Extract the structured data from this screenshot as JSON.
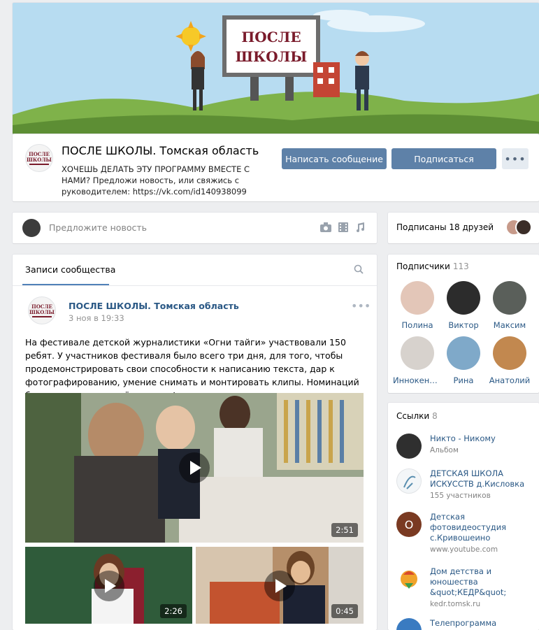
{
  "cover": {
    "sign_line1": "ПОСЛЕ",
    "sign_line2": "ШКОЛЫ"
  },
  "group": {
    "logo_line1": "ПОСЛЕ",
    "logo_line2": "ШКОЛЫ",
    "title": "ПОСЛЕ ШКОЛЫ. Томская область",
    "status": "ХОЧЕШЬ ДЕЛАТЬ ЭТУ ПРОГРАММУ ВМЕСТЕ С НАМИ? Предложи новость, или свяжись с руководителем: https://vk.com/id140938099"
  },
  "actions": {
    "message_label": "Написать сообщение",
    "subscribe_label": "Подписаться",
    "more_label": "•••"
  },
  "suggest": {
    "placeholder": "Предложите новость"
  },
  "wall": {
    "tab_label": "Записи сообщества",
    "post": {
      "author": "ПОСЛЕ ШКОЛЫ. Томская область",
      "date": "3 ноя в 19:33",
      "text": "На фестивале детской журналистики «Огни тайги» участвовали 150 ребят. У участников фестиваля было всего три дня, для того, чтобы продемонстрировать свои способности к написанию текста, дар к фотографированию, умение снимать и монтировать клипы. Номинаций было много, вот призёры видео!",
      "videos": [
        {
          "duration": "2:51"
        },
        {
          "duration": "2:26"
        },
        {
          "duration": "0:45"
        }
      ]
    }
  },
  "friends": {
    "label": "Подписаны 18 друзей"
  },
  "subscribers": {
    "title": "Подписчики",
    "count": "113",
    "people": [
      {
        "name": "Полина"
      },
      {
        "name": "Виктор"
      },
      {
        "name": "Максим"
      },
      {
        "name": "Иннокенти..."
      },
      {
        "name": "Рина"
      },
      {
        "name": "Анатолий"
      }
    ]
  },
  "links": {
    "title": "Ссылки",
    "count": "8",
    "items": [
      {
        "title": "Никто - Никому",
        "subtitle": "Альбом"
      },
      {
        "title": "ДЕТСКАЯ ШКОЛА ИСКУССТВ д.Кисловка",
        "subtitle": "155 участников"
      },
      {
        "title": "Детская фотовидеостудия с.Кривошеино",
        "subtitle": "www.youtube.com",
        "icon_letter": "О"
      },
      {
        "title": "Дом детства и юношества &quot;КЕДР&quot;",
        "subtitle": "kedr.tomsk.ru"
      },
      {
        "title": "Телепрограмма",
        "subtitle": ""
      }
    ]
  },
  "colors": {
    "accent": "#5e81a8",
    "link": "#2a5885",
    "background": "#edeef0",
    "sign_text": "#7a1b2b"
  }
}
